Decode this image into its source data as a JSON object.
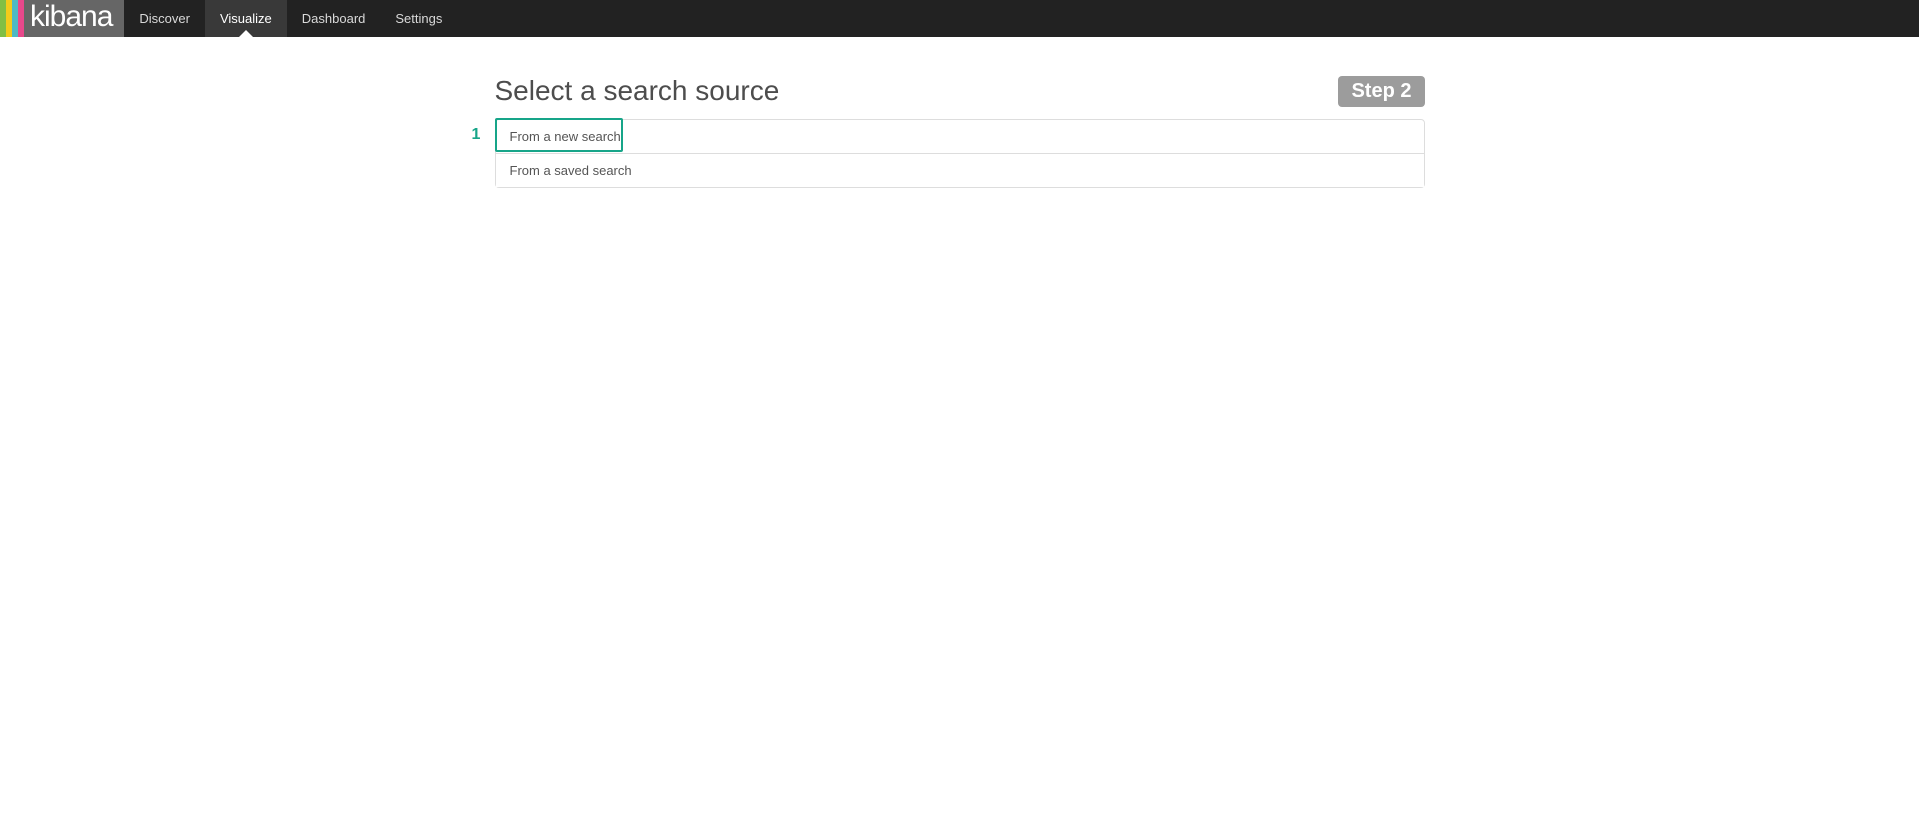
{
  "brand": "kibana",
  "nav": {
    "items": [
      {
        "label": "Discover",
        "active": false
      },
      {
        "label": "Visualize",
        "active": true
      },
      {
        "label": "Dashboard",
        "active": false
      },
      {
        "label": "Settings",
        "active": false
      }
    ]
  },
  "page": {
    "title": "Select a search source",
    "step_label": "Step 2"
  },
  "options": [
    {
      "label": "From a new search"
    },
    {
      "label": "From a saved search"
    }
  ],
  "annotation": {
    "number": "1"
  }
}
